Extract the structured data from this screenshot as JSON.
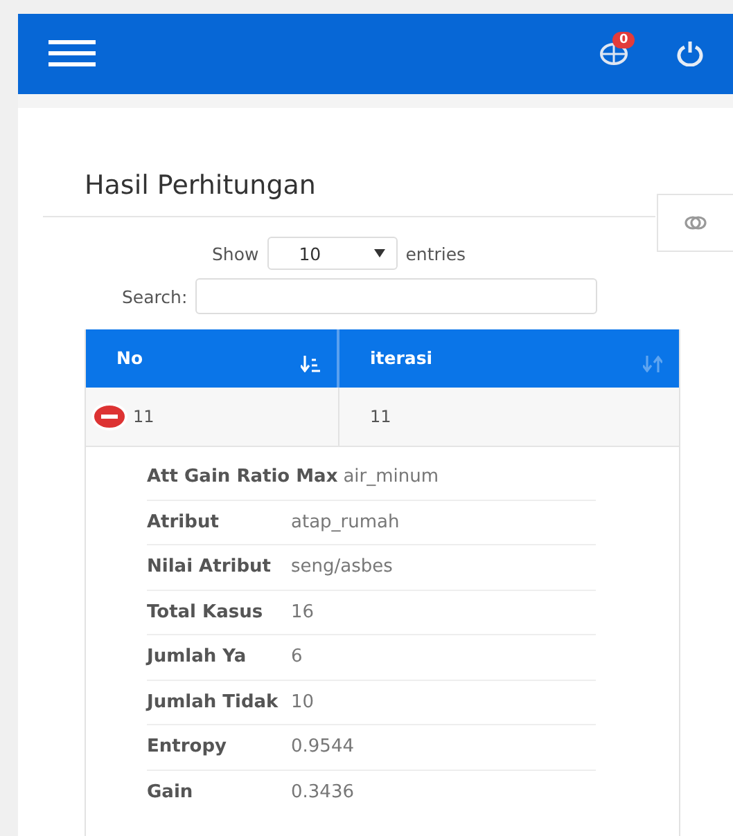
{
  "topbar": {
    "notification_count": "0"
  },
  "panel": {
    "title": "Hasil Perhitungan"
  },
  "length_control": {
    "label_before": "Show",
    "value": "10",
    "label_after": "entries"
  },
  "search": {
    "label": "Search:"
  },
  "table": {
    "columns": [
      {
        "label": "No",
        "sorted": true
      },
      {
        "label": "iterasi",
        "sorted": false
      }
    ],
    "rows": [
      {
        "cells": [
          "11",
          "11"
        ],
        "expanded": true,
        "details": [
          {
            "label": "Att Gain Ratio Max",
            "value": "air_minum"
          },
          {
            "label": "Atribut",
            "value": "atap_rumah"
          },
          {
            "label": "Nilai Atribut",
            "value": "seng/asbes"
          },
          {
            "label": "Total Kasus",
            "value": "16"
          },
          {
            "label": "Jumlah Ya",
            "value": "6"
          },
          {
            "label": "Jumlah Tidak",
            "value": "10"
          },
          {
            "label": "Entropy",
            "value": "0.9544"
          },
          {
            "label": "Gain",
            "value": "0.3436"
          }
        ]
      }
    ]
  }
}
